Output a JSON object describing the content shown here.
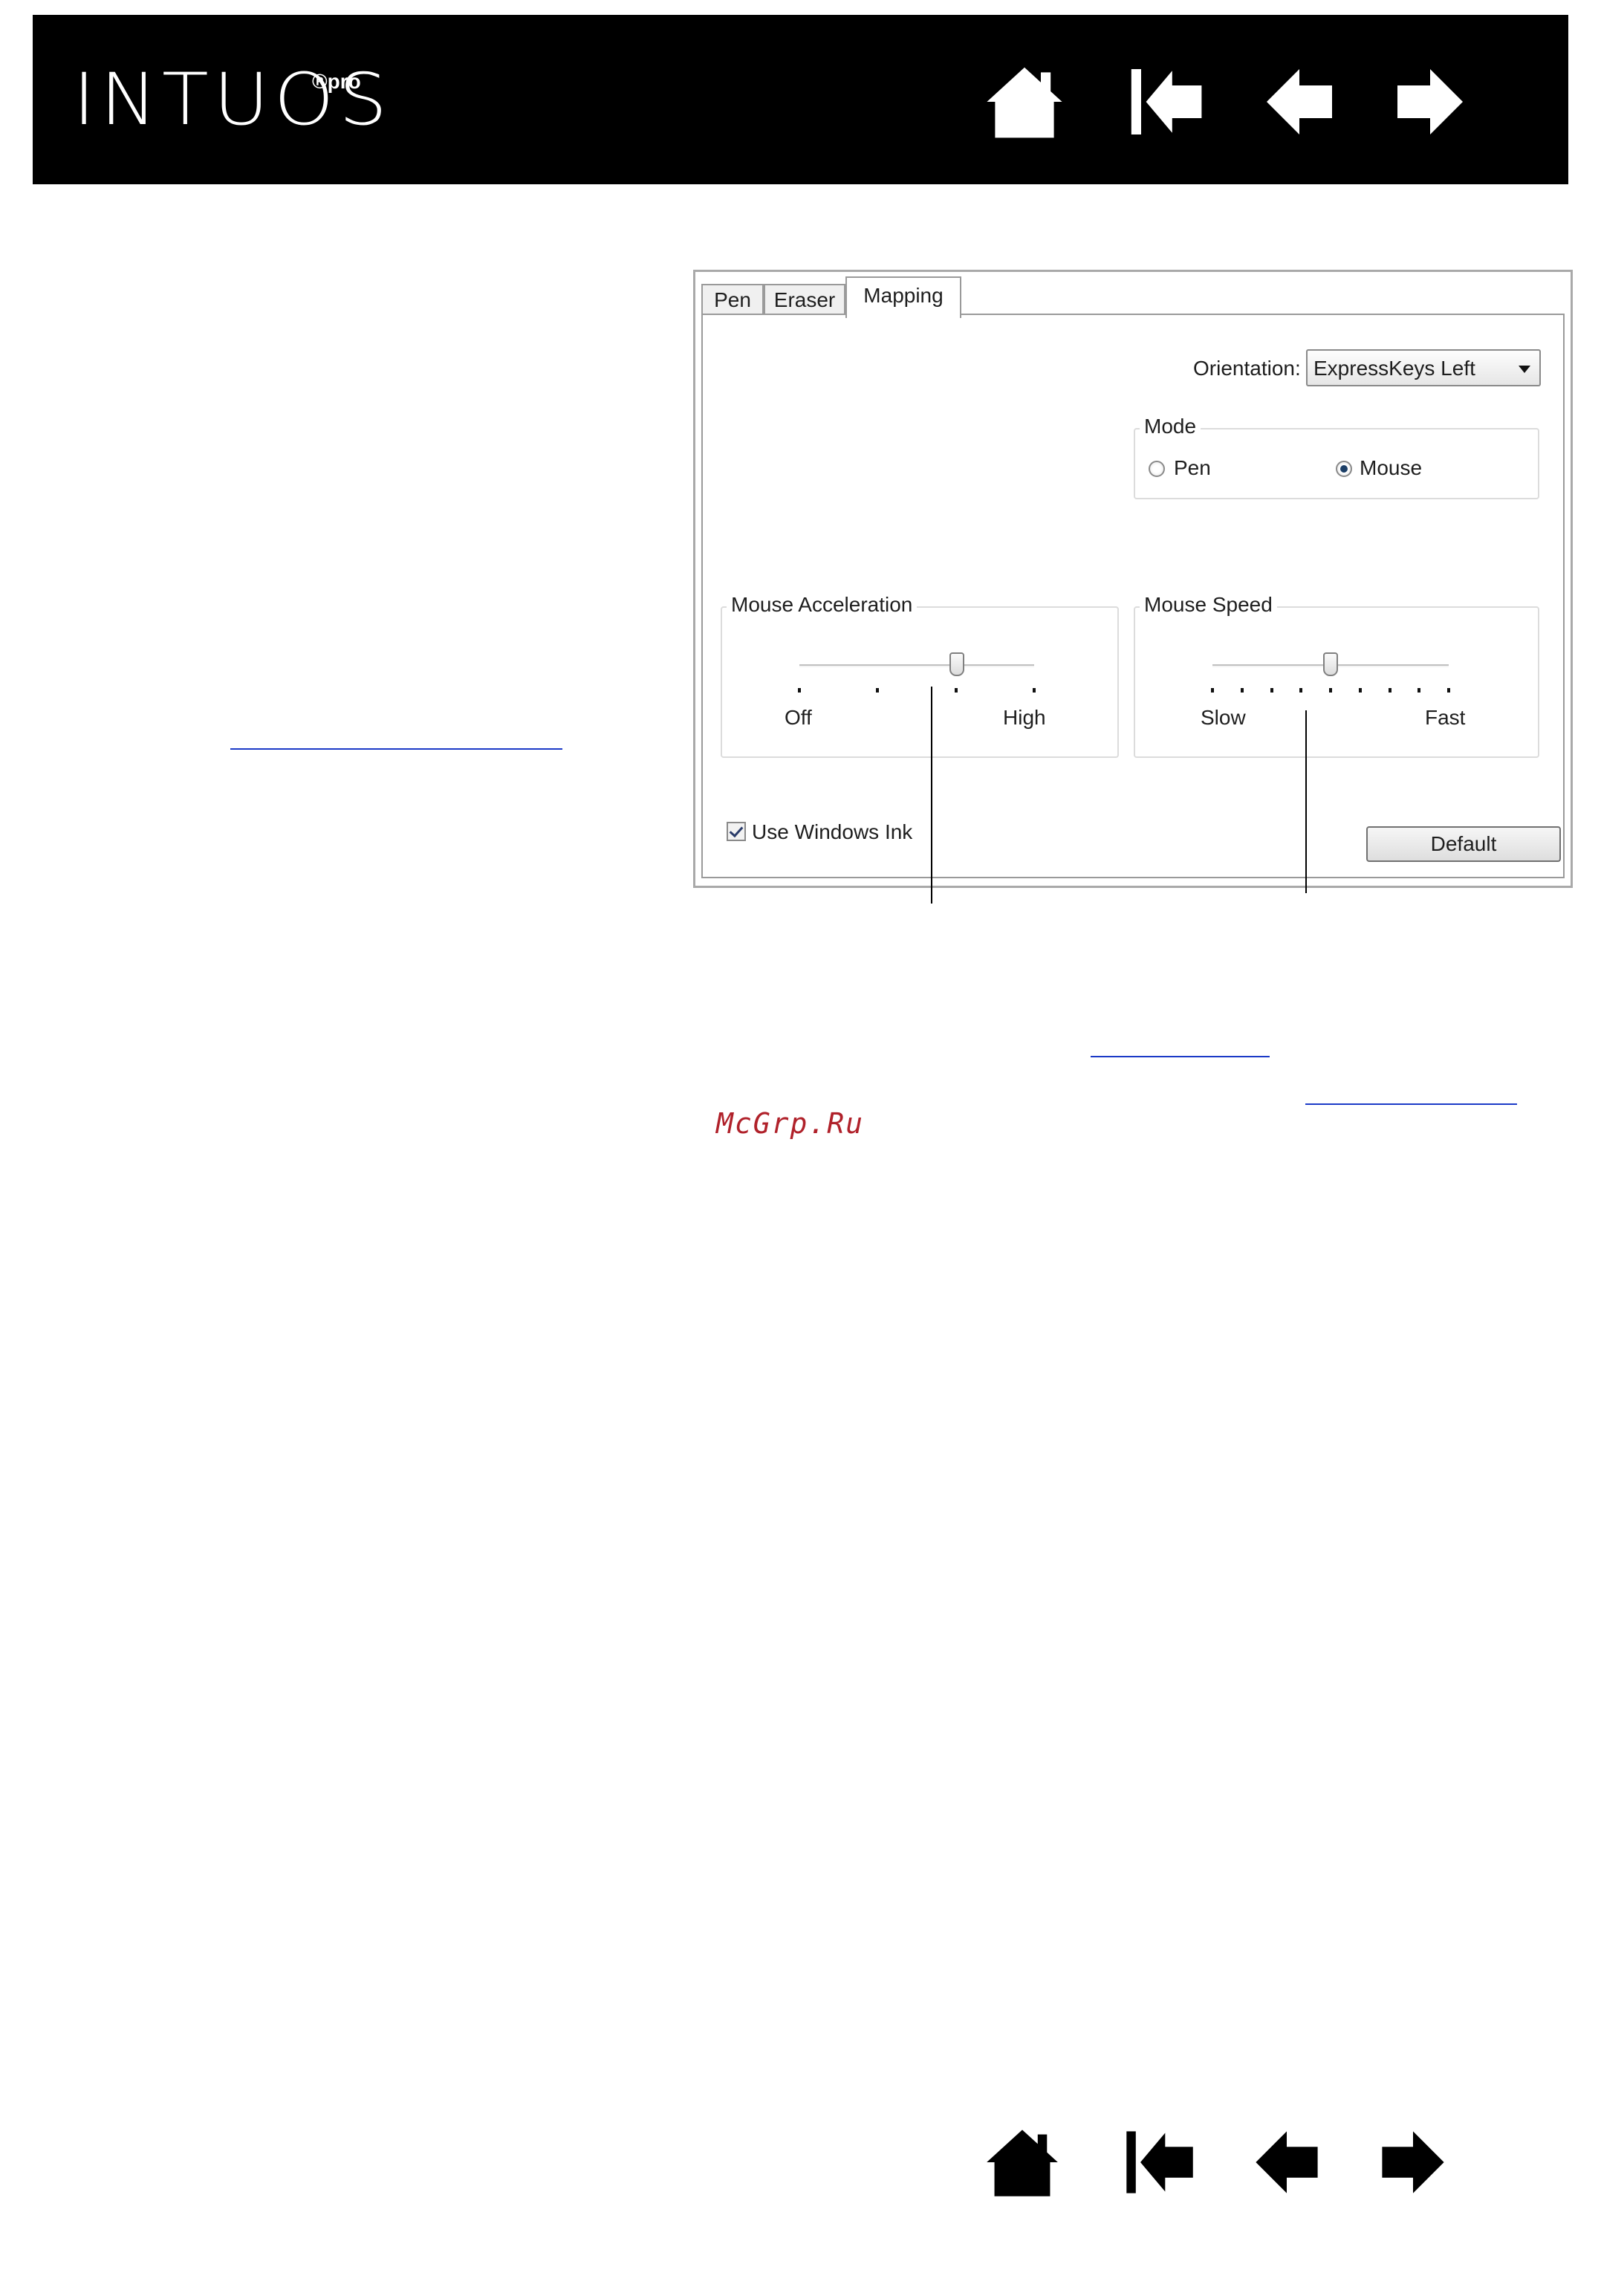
{
  "header": {
    "brand": "INTUOS",
    "brand_sup": "®pro"
  },
  "navigation": {
    "buttons": [
      "home-icon",
      "first-page-icon",
      "previous-page-icon",
      "next-page-icon"
    ]
  },
  "dialog": {
    "tabs": [
      "Pen",
      "Eraser",
      "Mapping"
    ],
    "active_tab": "Mapping",
    "orientation_label": "Orientation:",
    "orientation_value": "ExpressKeys Left",
    "mode": {
      "title": "Mode",
      "options": [
        "Pen",
        "Mouse"
      ],
      "selected": "Mouse"
    },
    "mouse_acceleration": {
      "title": "Mouse Acceleration",
      "min_label": "Off",
      "max_label": "High",
      "tick_count": 4,
      "value_fraction": 0.67
    },
    "mouse_speed": {
      "title": "Mouse Speed",
      "min_label": "Slow",
      "max_label": "Fast",
      "tick_count": 9,
      "value_fraction": 0.5
    },
    "use_windows_ink_label": "Use Windows Ink",
    "use_windows_ink_checked": true,
    "default_button": "Default"
  },
  "watermark": "McGrp.Ru",
  "colors": {
    "header_bg": "#000000",
    "link": "#1b3ac7",
    "watermark": "#b0212a"
  }
}
